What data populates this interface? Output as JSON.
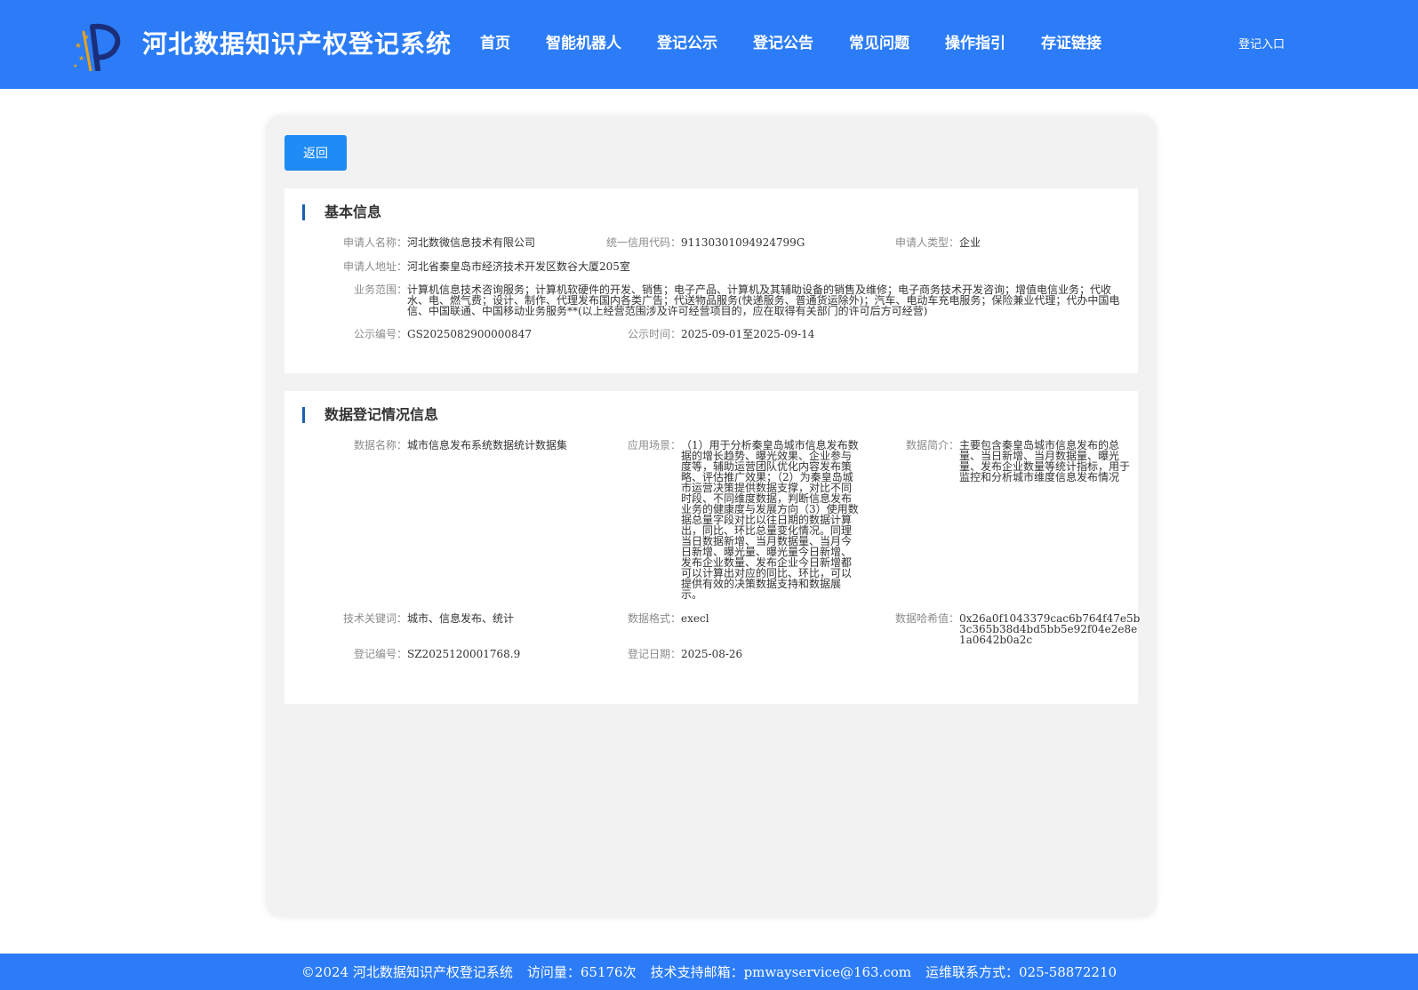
{
  "header": {
    "site_title": "河北数据知识产权登记系统",
    "nav": [
      "首页",
      "智能机器人",
      "登记公示",
      "登记公告",
      "常见问题",
      "操作指引",
      "存证链接"
    ],
    "login": "登记入口",
    "logo_icon": "hebei-logo-icon"
  },
  "actions": {
    "back": "返回"
  },
  "basic": {
    "title": "基本信息",
    "applicant_name_label": "申请人名称：",
    "applicant_name": "河北数微信息技术有限公司",
    "credit_code_label": "统一信用代码：",
    "credit_code": "91130301094924799G",
    "applicant_type_label": "申请人类型：",
    "applicant_type": "企业",
    "address_label": "申请人地址：",
    "address": "河北省秦皇岛市经济技术开发区数谷大厦205室",
    "scope_label": "业务范围：",
    "scope": "计算机信息技术咨询服务；计算机软硬件的开发、销售；电子产品、计算机及其辅助设备的销售及维修；电子商务技术开发咨询；增值电信业务；代收水、电、燃气费；设计、制作、代理发布国内各类广告；代送物品服务(快递服务、普通货运除外)；汽车、电动车充电服务；保险兼业代理；代办中国电信、中国联通、中国移动业务服务**(以上经营范围涉及许可经营项目的，应在取得有关部门的许可后方可经营)",
    "pub_no_label": "公示编号：",
    "pub_no": "GS2025082900000847",
    "pub_time_label": "公示时间：",
    "pub_time": "2025-09-01至2025-09-14"
  },
  "data_reg": {
    "title": "数据登记情况信息",
    "data_name_label": "数据名称：",
    "data_name": "城市信息发布系统数据统计数据集",
    "scenario_label": "应用场景：",
    "scenario": "（1）用于分析秦皇岛城市信息发布数据的增长趋势、曝光效果、企业参与度等，辅助运营团队优化内容发布策略、评估推广效果；（2）为秦皇岛城市运营决策提供数据支撑，对比不同时段、不同维度数据，判断信息发布业务的健康度与发展方向（3）使用数据总量字段对比以往日期的数据计算出，同比、环比总量变化情况。同理当日数据新增、当月数据量、当月今日新增、曝光量、曝光量今日新增、发布企业数量、发布企业今日新增都可以计算出对应的同比、环比，可以提供有效的决策数据支持和数据展示。",
    "intro_label": "数据简介：",
    "intro": "主要包含秦皇岛城市信息发布的总量、当日新增、当月数据量、曝光量、发布企业数量等统计指标，用于监控和分析城市维度信息发布情况",
    "keywords_label": "技术关键词：",
    "keywords": "城市、信息发布、统计",
    "format_label": "数据格式：",
    "format": "execl",
    "hash_label": "数据哈希值：",
    "hash": "0x26a0f1043379cac6b764f47e5b3c365b38d4bd5bb5e92f04e2e8e1a0642b0a2c",
    "reg_no_label": "登记编号：",
    "reg_no": "SZ2025120001768.9",
    "reg_date_label": "登记日期：",
    "reg_date": "2025-08-26"
  },
  "footer": {
    "copyright": "©2024 河北数据知识产权登记系统",
    "visits": "访问量：65176次",
    "support": "技术支持邮箱：pmwayservice@163.com",
    "contact": "运维联系方式：025-58872210"
  },
  "colors": {
    "primary": "#2b7cf6",
    "button": "#1f8bf5",
    "accent_bar": "#1a5fb4"
  }
}
